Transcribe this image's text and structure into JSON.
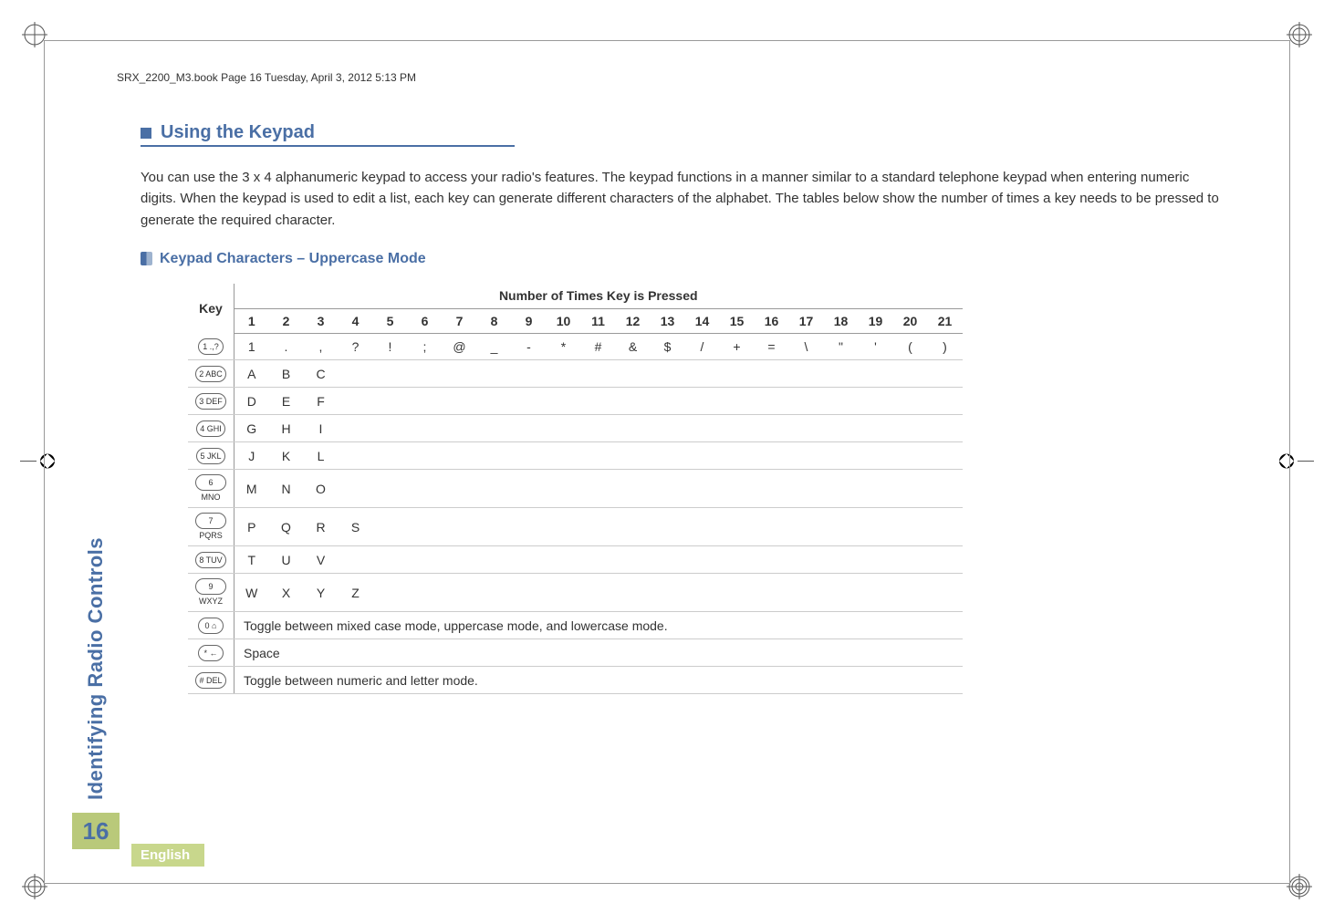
{
  "header_line": "SRX_2200_M3.book  Page 16  Tuesday, April 3, 2012  5:13 PM",
  "section_title": "Using the Keypad",
  "body_text": "You can use the 3 x 4 alphanumeric keypad to access your radio's features. The keypad functions in a manner similar to a standard telephone keypad when entering numeric digits. When the keypad is used to edit a list, each key can generate different characters of the alphabet. The tables below show the number of times a key needs to be pressed to generate the required character.",
  "subsection_title": "Keypad Characters – Uppercase Mode",
  "table": {
    "key_header": "Key",
    "super_header": "Number of Times Key is Pressed",
    "columns": [
      "1",
      "2",
      "3",
      "4",
      "5",
      "6",
      "7",
      "8",
      "9",
      "10",
      "11",
      "12",
      "13",
      "14",
      "15",
      "16",
      "17",
      "18",
      "19",
      "20",
      "21"
    ],
    "rows": [
      {
        "keycap": "1 .,?",
        "cells": [
          "1",
          ".",
          ",",
          "?",
          "!",
          ";",
          "@",
          "_",
          "-",
          "*",
          "#",
          "&",
          "$",
          "/",
          "+",
          "=",
          "\\",
          "\"",
          "'",
          "(",
          ")"
        ]
      },
      {
        "keycap": "2 ABC",
        "cells": [
          "A",
          "B",
          "C",
          "",
          "",
          "",
          "",
          "",
          "",
          "",
          "",
          "",
          "",
          "",
          "",
          "",
          "",
          "",
          "",
          "",
          ""
        ]
      },
      {
        "keycap": "3 DEF",
        "cells": [
          "D",
          "E",
          "F",
          "",
          "",
          "",
          "",
          "",
          "",
          "",
          "",
          "",
          "",
          "",
          "",
          "",
          "",
          "",
          "",
          "",
          ""
        ]
      },
      {
        "keycap": "4 GHI",
        "cells": [
          "G",
          "H",
          "I",
          "",
          "",
          "",
          "",
          "",
          "",
          "",
          "",
          "",
          "",
          "",
          "",
          "",
          "",
          "",
          "",
          "",
          ""
        ]
      },
      {
        "keycap": "5 JKL",
        "cells": [
          "J",
          "K",
          "L",
          "",
          "",
          "",
          "",
          "",
          "",
          "",
          "",
          "",
          "",
          "",
          "",
          "",
          "",
          "",
          "",
          "",
          ""
        ]
      },
      {
        "keycap": "6 MNO",
        "cells": [
          "M",
          "N",
          "O",
          "",
          "",
          "",
          "",
          "",
          "",
          "",
          "",
          "",
          "",
          "",
          "",
          "",
          "",
          "",
          "",
          "",
          ""
        ]
      },
      {
        "keycap": "7 PQRS",
        "cells": [
          "P",
          "Q",
          "R",
          "S",
          "",
          "",
          "",
          "",
          "",
          "",
          "",
          "",
          "",
          "",
          "",
          "",
          "",
          "",
          "",
          "",
          ""
        ]
      },
      {
        "keycap": "8 TUV",
        "cells": [
          "T",
          "U",
          "V",
          "",
          "",
          "",
          "",
          "",
          "",
          "",
          "",
          "",
          "",
          "",
          "",
          "",
          "",
          "",
          "",
          "",
          ""
        ]
      },
      {
        "keycap": "9 WXYZ",
        "cells": [
          "W",
          "X",
          "Y",
          "Z",
          "",
          "",
          "",
          "",
          "",
          "",
          "",
          "",
          "",
          "",
          "",
          "",
          "",
          "",
          "",
          "",
          ""
        ]
      },
      {
        "keycap": "0 ⌂",
        "note": "Toggle between mixed case mode, uppercase mode, and lowercase mode."
      },
      {
        "keycap": "* ←",
        "note": "Space"
      },
      {
        "keycap": "# DEL",
        "note": "Toggle between numeric and letter mode."
      }
    ]
  },
  "sidebar_text": "Identifying Radio Controls",
  "page_number": "16",
  "language": "English"
}
